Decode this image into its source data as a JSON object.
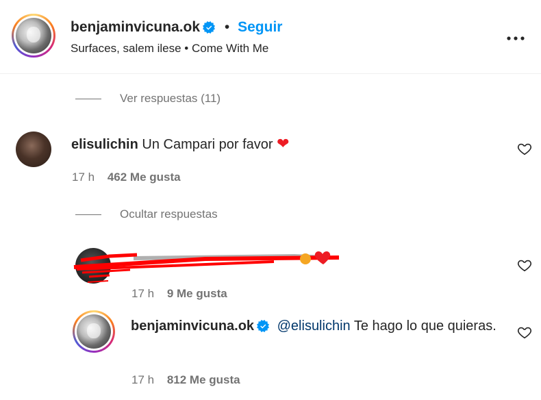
{
  "header": {
    "username": "benjaminvicuna.ok",
    "separator": "•",
    "follow_label": "Seguir",
    "audio_text": "Surfaces, salem ilese • Come With Me",
    "more_icon": "more-horizontal-icon"
  },
  "thread": {
    "view_replies_label": "Ver respuestas (11)",
    "hide_replies_label": "Ocultar respuestas"
  },
  "comments": [
    {
      "username": "elisulichin",
      "text": "Un Campari por favor",
      "emoji": "❤️",
      "time": "17 h",
      "likes": "462 Me gusta"
    },
    {
      "username": "",
      "text": "",
      "time": "17 h",
      "likes": "9 Me gusta"
    },
    {
      "username": "benjaminvicuna.ok",
      "mention": "@elisulichin",
      "text": "Te hago lo que quieras.",
      "time": "17 h",
      "likes": "812 Me gusta"
    }
  ],
  "colors": {
    "follow_blue": "#0095f6",
    "verified_blue": "#0095f6",
    "heart_red": "#ed1c24",
    "redaction_red": "#ff0000"
  }
}
